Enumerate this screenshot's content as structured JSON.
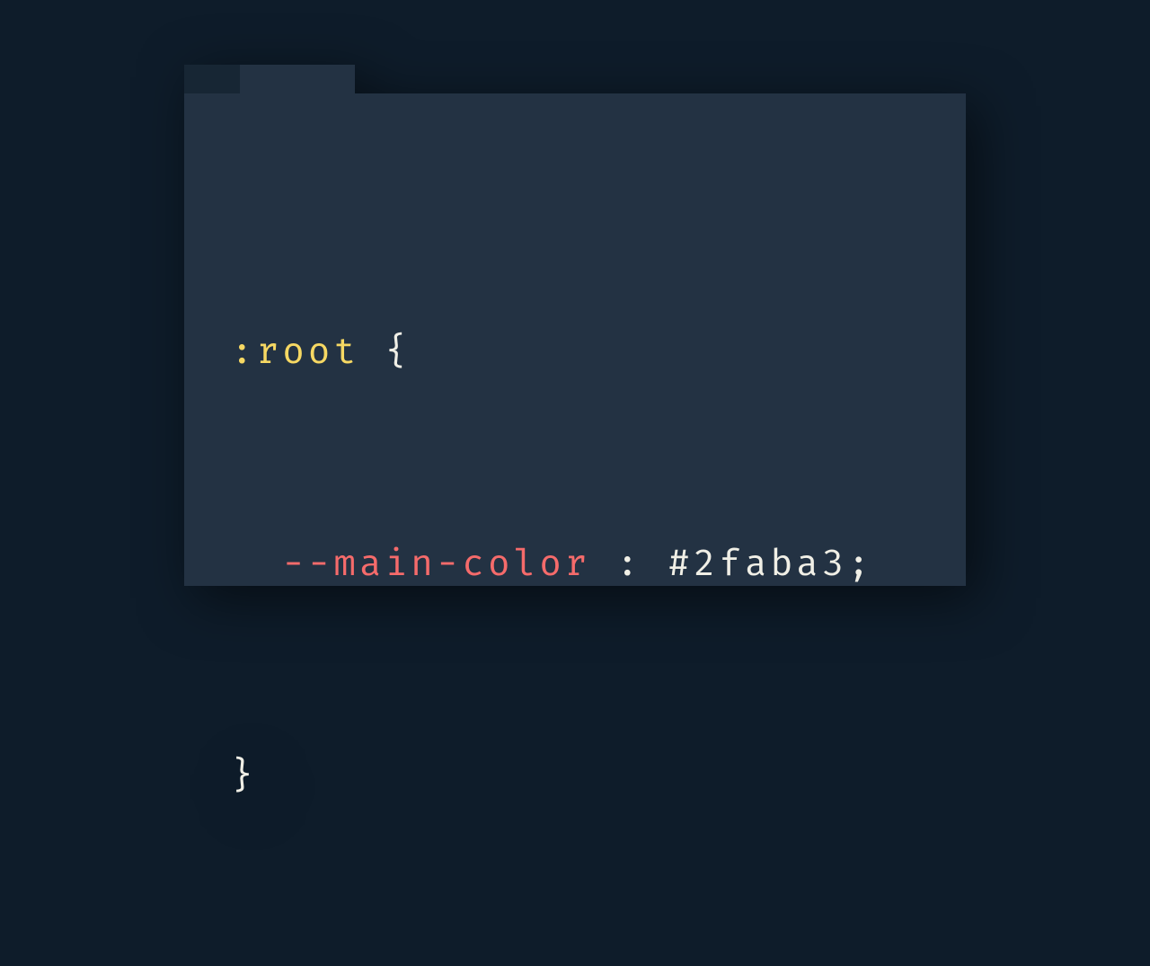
{
  "code": {
    "line1": {
      "selector": ":root",
      "brace_open": " {"
    },
    "line2": {
      "indent": "  ",
      "property": "--main-color",
      "colon": " : ",
      "value": "#2faba3;"
    },
    "line3": {
      "brace_close": "}"
    }
  },
  "colors": {
    "background": "#0e1c2a",
    "editor_bg": "#233243",
    "tab_inactive_bg": "#172634",
    "selector": "#f6d863",
    "property": "#f56b6b",
    "default_text": "#f0efe6"
  }
}
